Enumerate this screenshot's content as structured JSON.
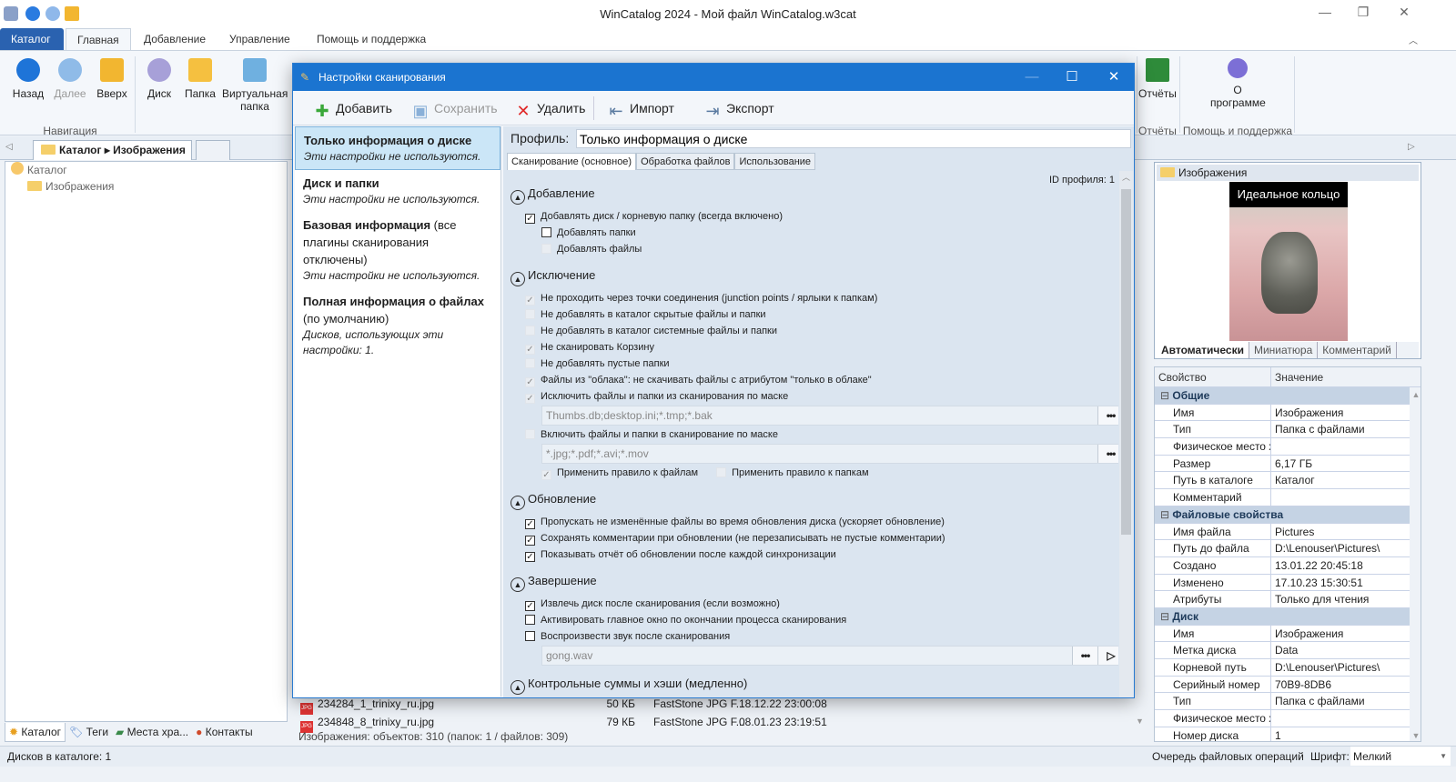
{
  "window": {
    "title": "WinCatalog 2024 - Мой файл WinCatalog.w3cat",
    "minimize": "—",
    "maximize": "❐",
    "close": "✕"
  },
  "ribbon": {
    "tabs": [
      "Каталог",
      "Главная",
      "Добавление",
      "Управление",
      "Помощь и поддержка"
    ],
    "active_tab": "Главная",
    "nav": {
      "back": "Назад",
      "forward": "Далее",
      "up": "Вверх",
      "group": "Навигация"
    },
    "add": {
      "disk": "Диск",
      "folder": "Папка",
      "virtual": "Виртуальная папка"
    },
    "reports": {
      "button": "Отчёты",
      "group": "Отчёты"
    },
    "help": {
      "about": "О программе",
      "group": "Помощь и поддержка"
    }
  },
  "doc_tab": {
    "label": "Каталог ▸ Изображения"
  },
  "tree": [
    {
      "label": "Каталог",
      "icon": "catalog-icon"
    },
    {
      "label": "Изображения",
      "icon": "folder-icon"
    }
  ],
  "bottom_tabs": [
    "Каталог",
    "Теги",
    "Места хра...",
    "Контакты"
  ],
  "files": [
    {
      "name": "234284_1_trinixy_ru.jpg",
      "size": "50 КБ",
      "type": "FastStone JPG F...",
      "date": "18.12.22 23:00:08"
    },
    {
      "name": "234848_8_trinixy_ru.jpg",
      "size": "79 КБ",
      "type": "FastStone JPG F...",
      "date": "08.01.23 23:19:51"
    }
  ],
  "list_status": "Изображения: объектов: 310 (папок: 1 / файлов: 309)",
  "statusbar": {
    "left": "Дисков в каталоге: 1",
    "queue": "Очередь файловых операций",
    "font_label": "Шрифт:",
    "font_value": "Мелкий"
  },
  "preview": {
    "title": "Изображения",
    "image_caption": "Идеальное кольцо",
    "tabs": [
      "Автоматически",
      "Миниатюра",
      "Комментарий"
    ],
    "active_tab": "Автоматически"
  },
  "properties": {
    "headers": [
      "Свойство",
      "Значение"
    ],
    "groups": [
      {
        "name": "Общие",
        "rows": [
          [
            "Имя",
            "Изображения"
          ],
          [
            "Тип",
            "Папка с файлами"
          ],
          [
            "Физическое место х...",
            ""
          ],
          [
            "Размер",
            "6,17 ГБ"
          ],
          [
            "Путь в каталоге",
            "Каталог"
          ],
          [
            "Комментарий",
            ""
          ]
        ]
      },
      {
        "name": "Файловые свойства",
        "rows": [
          [
            "Имя файла",
            "Pictures"
          ],
          [
            "Путь до файла",
            "D:\\Lenouser\\Pictures\\"
          ],
          [
            "Создано",
            "13.01.22 20:45:18"
          ],
          [
            "Изменено",
            "17.10.23 15:30:51"
          ],
          [
            "Атрибуты",
            "Только для чтения"
          ]
        ]
      },
      {
        "name": "Диск",
        "rows": [
          [
            "Имя",
            "Изображения"
          ],
          [
            "Метка диска",
            "Data"
          ],
          [
            "Корневой путь",
            "D:\\Lenouser\\Pictures\\"
          ],
          [
            "Серийный номер",
            "70B9-8DB6"
          ],
          [
            "Тип",
            "Папка с файлами"
          ],
          [
            "Физическое место х...",
            ""
          ],
          [
            "Номер диска",
            "1"
          ]
        ]
      }
    ]
  },
  "dialog": {
    "title": "Настройки сканирования",
    "toolbar": {
      "add": "Добавить",
      "save": "Сохранить",
      "delete": "Удалить",
      "import": "Импорт",
      "export": "Экспорт"
    },
    "profiles": [
      {
        "bold": "Только информация о диске",
        "normal": "",
        "note": "Эти настройки не используются.",
        "selected": true
      },
      {
        "bold": "Диск и папки",
        "normal": "",
        "note": "Эти настройки не используются."
      },
      {
        "bold": "Базовая информация",
        "normal": " (все плагины сканирования отключены)",
        "note": "Эти настройки не используются."
      },
      {
        "bold": "Полная информация о файлах",
        "normal": " (по умолчанию)",
        "note": "Дисков, использующих эти настройки: 1."
      }
    ],
    "profile_label": "Профиль:",
    "profile_value": "Только информация о диске",
    "tabs": [
      "Сканирование (основное)",
      "Обработка файлов",
      "Использование"
    ],
    "active_tab": "Сканирование (основное)",
    "profile_id": "ID профиля: 1",
    "sections": [
      {
        "title": "Добавление",
        "items": [
          {
            "type": "check",
            "label": "Добавлять диск / корневую папку (всегда включено)",
            "checked": true,
            "enabled": true
          },
          {
            "type": "check",
            "label": "Добавлять папки",
            "checked": false,
            "enabled": true,
            "indent": true
          },
          {
            "type": "check",
            "label": "Добавлять файлы",
            "checked": false,
            "enabled": false,
            "indent": true
          }
        ]
      },
      {
        "title": "Исключение",
        "items": [
          {
            "type": "check",
            "label": "Не проходить через точки соединения (junction points / ярлыки к папкам)",
            "checked": true,
            "enabled": false
          },
          {
            "type": "check",
            "label": "Не добавлять в каталог скрытые файлы и папки",
            "checked": false,
            "enabled": false
          },
          {
            "type": "check",
            "label": "Не добавлять в каталог системные файлы и папки",
            "checked": false,
            "enabled": false
          },
          {
            "type": "check",
            "label": "Не сканировать Корзину",
            "checked": true,
            "enabled": false
          },
          {
            "type": "check",
            "label": "Не добавлять пустые папки",
            "checked": false,
            "enabled": false
          },
          {
            "type": "check",
            "label": "Файлы из \"облака\": не скачивать файлы с атрибутом \"только в облаке\"",
            "checked": true,
            "enabled": false
          },
          {
            "type": "check",
            "label": "Исключить файлы и папки из сканирования по маске",
            "checked": true,
            "enabled": false
          },
          {
            "type": "input",
            "value": "Thumbs.db;desktop.ini;*.tmp;*.bak",
            "button": "•••"
          },
          {
            "type": "check",
            "label": "Включить файлы и папки в сканирование по маске",
            "checked": false,
            "enabled": false
          },
          {
            "type": "input",
            "value": "*.jpg;*.pdf;*.avi;*.mov",
            "button": "•••"
          },
          {
            "type": "pair",
            "items": [
              {
                "label": "Применить правило к файлам",
                "checked": true,
                "enabled": false
              },
              {
                "label": "Применить правило к папкам",
                "checked": false,
                "enabled": false
              }
            ]
          }
        ]
      },
      {
        "title": "Обновление",
        "items": [
          {
            "type": "check",
            "label": "Пропускать не изменённые файлы во время обновления диска (ускоряет обновление)",
            "checked": true,
            "enabled": true
          },
          {
            "type": "check",
            "label": "Сохранять комментарии при обновлении (не перезаписывать не пустые комментарии)",
            "checked": true,
            "enabled": true
          },
          {
            "type": "check",
            "label": "Показывать отчёт об обновлении после каждой синхронизации",
            "checked": true,
            "enabled": true
          }
        ]
      },
      {
        "title": "Завершение",
        "items": [
          {
            "type": "check",
            "label": "Извлечь диск после сканирования (если возможно)",
            "checked": true,
            "enabled": true
          },
          {
            "type": "check",
            "label": "Активировать главное окно по окончании процесса сканирования",
            "checked": false,
            "enabled": true
          },
          {
            "type": "check",
            "label": "Воспроизвести звук после сканирования",
            "checked": false,
            "enabled": true
          },
          {
            "type": "input",
            "value": "gong.wav",
            "button": "•••",
            "play": "▷"
          }
        ]
      },
      {
        "title": "Контрольные суммы и хэши (медленно)",
        "items": []
      }
    ]
  }
}
